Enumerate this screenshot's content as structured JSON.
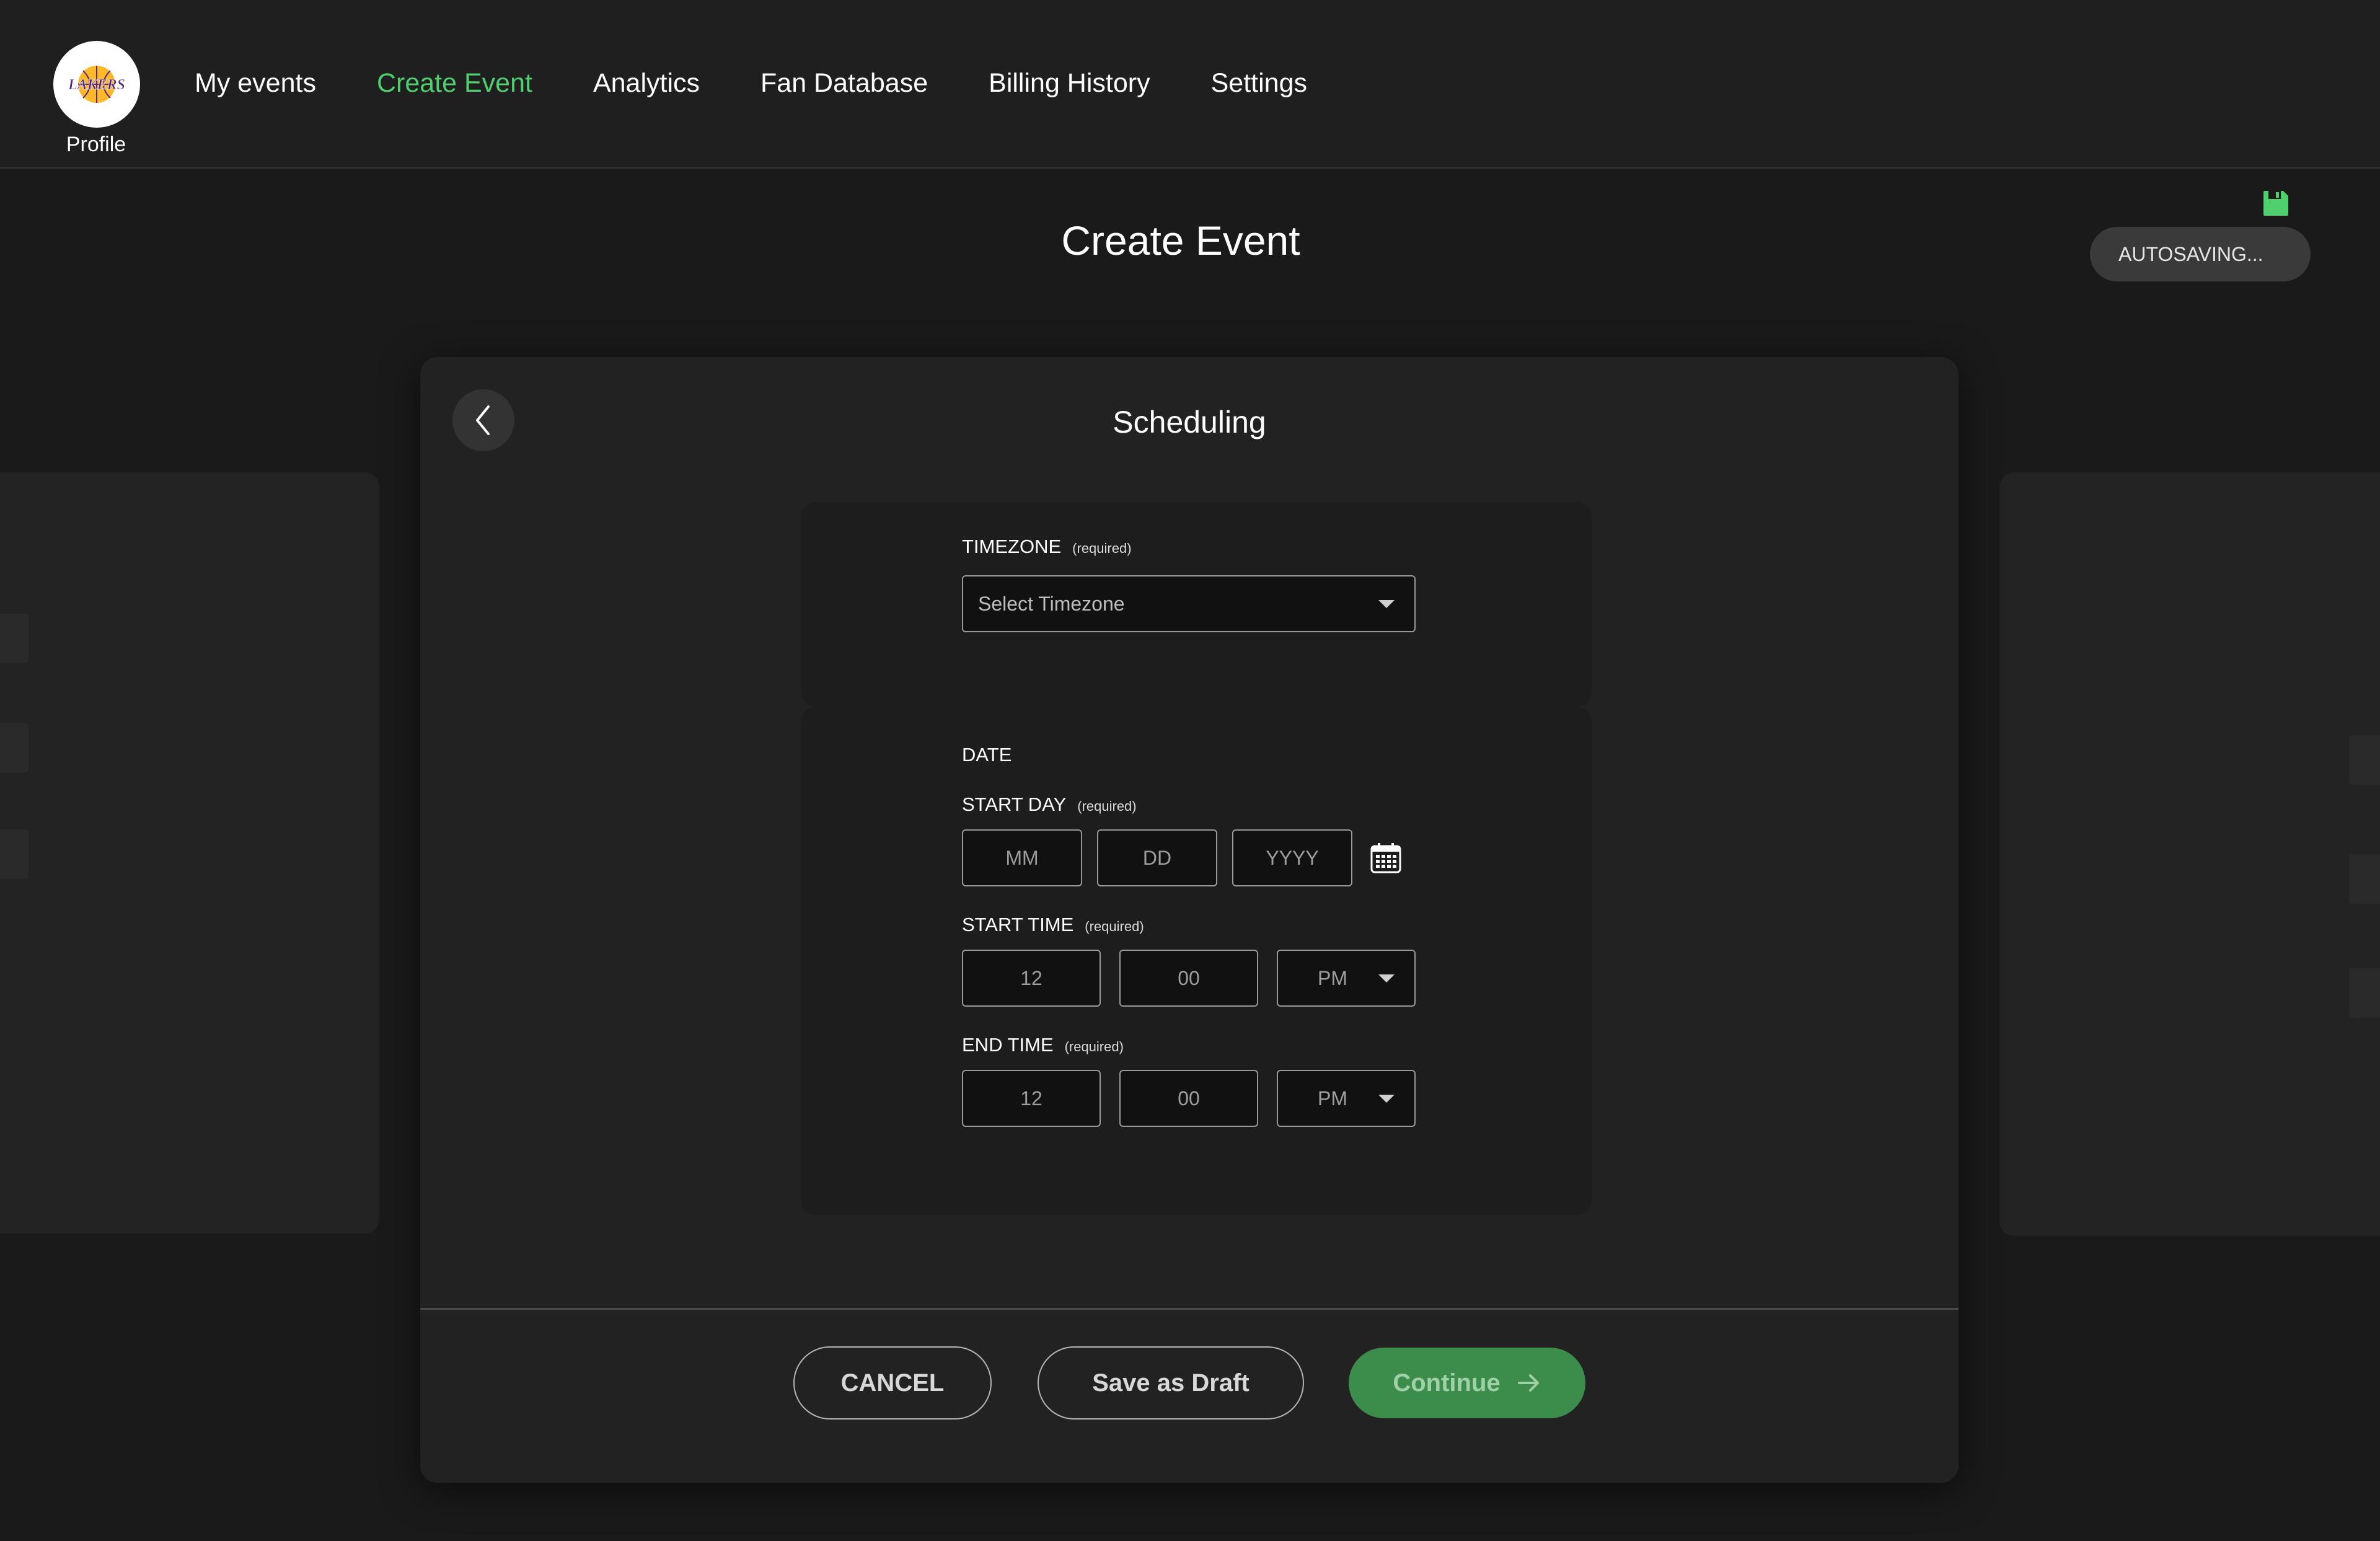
{
  "nav": {
    "profile_label": "Profile",
    "logo_text": "LAKERS",
    "items": [
      {
        "label": "My events",
        "active": false
      },
      {
        "label": "Create Event",
        "active": true
      },
      {
        "label": "Analytics",
        "active": false
      },
      {
        "label": "Fan Database",
        "active": false
      },
      {
        "label": "Billing History",
        "active": false
      },
      {
        "label": "Settings",
        "active": false
      }
    ]
  },
  "header": {
    "title": "Create Event",
    "autosave_label": "AUTOSAVING..."
  },
  "card": {
    "title": "Scheduling",
    "timezone": {
      "label": "TIMEZONE",
      "required": "(required)",
      "placeholder": "Select Timezone"
    },
    "date": {
      "section_label": "DATE",
      "start_day": {
        "label": "START DAY",
        "required": "(required)",
        "month_placeholder": "MM",
        "day_placeholder": "DD",
        "year_placeholder": "YYYY"
      },
      "start_time": {
        "label": "START TIME",
        "required": "(required)",
        "hour": "12",
        "minute": "00",
        "period": "PM"
      },
      "end_time": {
        "label": "END TIME",
        "required": "(required)",
        "hour": "12",
        "minute": "00",
        "period": "PM"
      }
    },
    "actions": {
      "cancel": "CANCEL",
      "save_draft": "Save as Draft",
      "continue": "Continue"
    }
  },
  "colors": {
    "accent_green": "#4fcf6e",
    "continue_bg": "#3c8c4c",
    "background": "#1a1a1a",
    "card_bg": "#222222",
    "lakers_purple": "#552583",
    "lakers_gold": "#fdb927"
  },
  "icons": {
    "save": "floppy-disk-icon",
    "back": "chevron-left-icon",
    "calendar": "calendar-icon",
    "dropdown": "caret-down-icon",
    "continue": "arrow-right-icon"
  }
}
